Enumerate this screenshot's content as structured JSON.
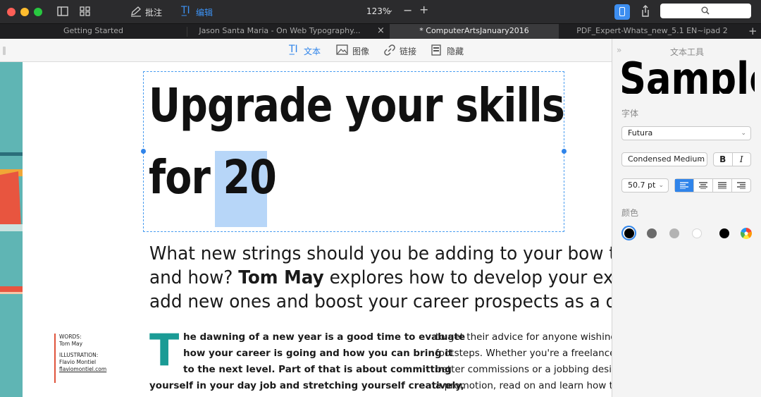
{
  "titlebar": {
    "annotate_label": "批注",
    "edit_label": "编辑",
    "zoom": "123%"
  },
  "tabs": [
    {
      "label": "Getting Started"
    },
    {
      "label": "Jason Santa Maria - On Web Typography..."
    },
    {
      "label": "* ComputerArtsJanuary2016"
    },
    {
      "label": "PDF_Expert-Whats_new_5.1 EN~ipad 2"
    }
  ],
  "edit_toolbar": {
    "text_label": "文本",
    "image_label": "图像",
    "link_label": "链接",
    "hide_label": "隐藏"
  },
  "document": {
    "headline_line1": "Upgrade your skills",
    "headline_line2_a": "for ",
    "headline_line2_b": "20",
    "standfirst_line1": "What new strings should you be adding to your bow th",
    "standfirst_line2_a": "and how? ",
    "standfirst_line2_b": "Tom May",
    "standfirst_line2_c": " explores how to develop your exis",
    "standfirst_line3": "add new ones and boost your career prospects as a d",
    "credits": {
      "words_label": "WORDS:",
      "words_name": "Tom May",
      "illustration_label": "ILLUSTRATION:",
      "illustration_name": "Flavio Montiel",
      "illustration_site": "flaviomontiel.com"
    },
    "dropcap": "T",
    "col1": [
      "he dawning of a new year is a good time to evaluate",
      "how your career is going and how you can bring it",
      "to the next level. Part of that is about committing",
      "yourself in your day job and stretching yourself creatively,"
    ],
    "col2": [
      "to get their advice for anyone wishing t",
      "footsteps. Whether you're a freelancer",
      "better commissions or a jobbing design",
      "a promotion, read on and learn how to"
    ]
  },
  "panel": {
    "title": "文本工具",
    "sample_text": "Sample",
    "font_section": "字体",
    "font_family": "Futura",
    "font_style": "Condensed Medium",
    "bold_label": "B",
    "italic_label": "I",
    "font_size": "50.7 pt",
    "color_section": "颜色",
    "swatches": [
      "#000000",
      "#6b6b6b",
      "#b3b3b3",
      "#ffffff",
      "#000000"
    ],
    "selected_swatch": 0,
    "selected_alignment": "left"
  }
}
